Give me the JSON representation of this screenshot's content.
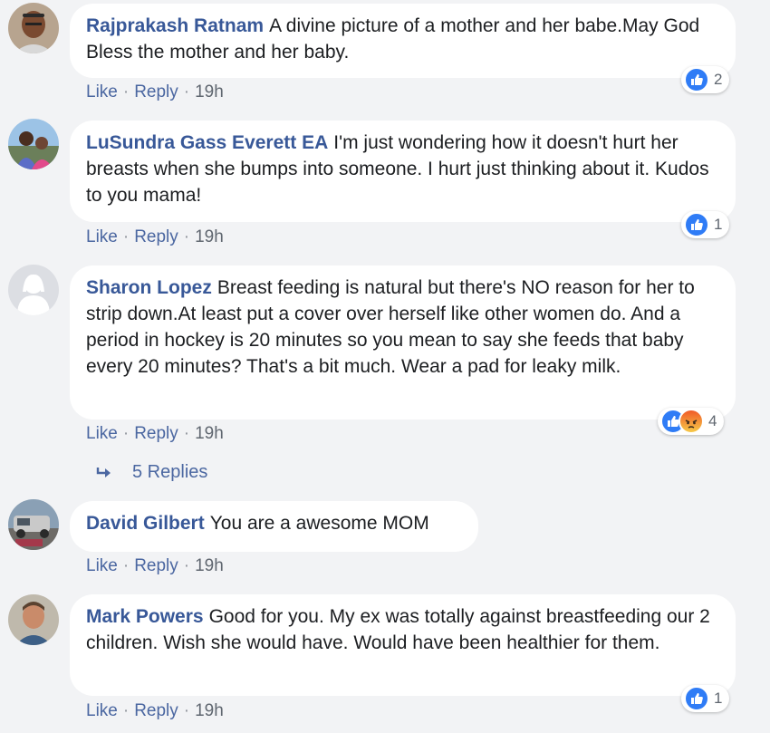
{
  "comments": [
    {
      "author": "Rajprakash Ratnam",
      "text": "A divine picture of a mother and her babe.May God Bless the mother and her baby.",
      "actions": {
        "like": "Like",
        "reply": "Reply",
        "time": "19h"
      },
      "reactions": {
        "icons": [
          "like-icon"
        ],
        "count": "2"
      }
    },
    {
      "author": "LuSundra Gass Everett EA",
      "text": "I'm just wondering how it doesn't hurt her breasts when she bumps into someone. I hurt just thinking about it. Kudos to you mama!",
      "actions": {
        "like": "Like",
        "reply": "Reply",
        "time": "19h"
      },
      "reactions": {
        "icons": [
          "like-icon"
        ],
        "count": "1"
      }
    },
    {
      "author": "Sharon Lopez",
      "text": "Breast feeding is natural but there's NO reason for her to strip down.At least put a cover over herself like other women do. And a period in hockey is 20 minutes so you mean to say she feeds that baby every 20 minutes? That's a bit much. Wear a pad for leaky milk.",
      "actions": {
        "like": "Like",
        "reply": "Reply",
        "time": "19h"
      },
      "reactions": {
        "icons": [
          "like-icon",
          "angry-icon"
        ],
        "count": "4"
      },
      "replies_label": "5 Replies"
    },
    {
      "author": "David Gilbert",
      "text": "You are a awesome MOM",
      "actions": {
        "like": "Like",
        "reply": "Reply",
        "time": "19h"
      }
    },
    {
      "author": "Mark Powers",
      "text": "Good for you. My ex was totally against breastfeeding our 2 children. Wish she would have. Would have been healthier for them.",
      "actions": {
        "like": "Like",
        "reply": "Reply",
        "time": "19h"
      },
      "reactions": {
        "icons": [
          "like-icon"
        ],
        "count": "1"
      }
    }
  ],
  "colors": {
    "author": "#385898",
    "link": "#4b67a1",
    "like_blue": "#2f7cf6",
    "background": "#f2f3f5"
  }
}
